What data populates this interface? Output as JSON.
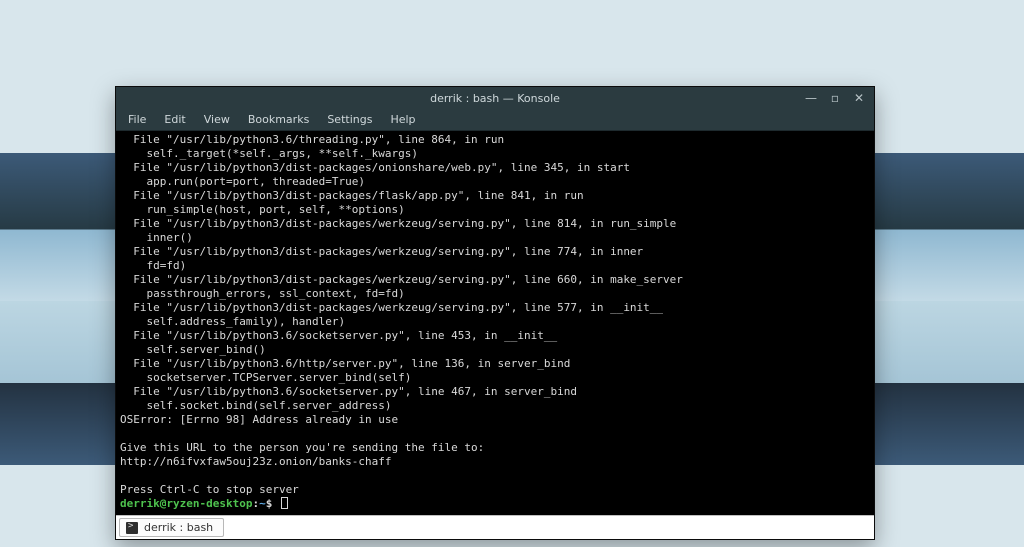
{
  "window": {
    "title": "derrik : bash — Konsole"
  },
  "wincontrols": {
    "minimize": "—",
    "maximize": "▫",
    "close": "✕"
  },
  "menubar": {
    "items": [
      "File",
      "Edit",
      "View",
      "Bookmarks",
      "Settings",
      "Help"
    ]
  },
  "terminal": {
    "lines": [
      "  File \"/usr/lib/python3.6/threading.py\", line 864, in run",
      "    self._target(*self._args, **self._kwargs)",
      "  File \"/usr/lib/python3/dist-packages/onionshare/web.py\", line 345, in start",
      "    app.run(port=port, threaded=True)",
      "  File \"/usr/lib/python3/dist-packages/flask/app.py\", line 841, in run",
      "    run_simple(host, port, self, **options)",
      "  File \"/usr/lib/python3/dist-packages/werkzeug/serving.py\", line 814, in run_simple",
      "    inner()",
      "  File \"/usr/lib/python3/dist-packages/werkzeug/serving.py\", line 774, in inner",
      "    fd=fd)",
      "  File \"/usr/lib/python3/dist-packages/werkzeug/serving.py\", line 660, in make_server",
      "    passthrough_errors, ssl_context, fd=fd)",
      "  File \"/usr/lib/python3/dist-packages/werkzeug/serving.py\", line 577, in __init__",
      "    self.address_family), handler)",
      "  File \"/usr/lib/python3.6/socketserver.py\", line 453, in __init__",
      "    self.server_bind()",
      "  File \"/usr/lib/python3.6/http/server.py\", line 136, in server_bind",
      "    socketserver.TCPServer.server_bind(self)",
      "  File \"/usr/lib/python3.6/socketserver.py\", line 467, in server_bind",
      "    self.socket.bind(self.server_address)",
      "OSError: [Errno 98] Address already in use",
      "",
      "Give this URL to the person you're sending the file to:",
      "http://n6ifvxfaw5ouj23z.onion/banks-chaff",
      "",
      "Press Ctrl-C to stop server"
    ],
    "prompt": {
      "userhost": "derrik@ryzen-desktop",
      "colon": ":",
      "path": "~",
      "sigil": "$"
    }
  },
  "tabbar": {
    "tabs": [
      {
        "label": "derrik : bash"
      }
    ]
  }
}
